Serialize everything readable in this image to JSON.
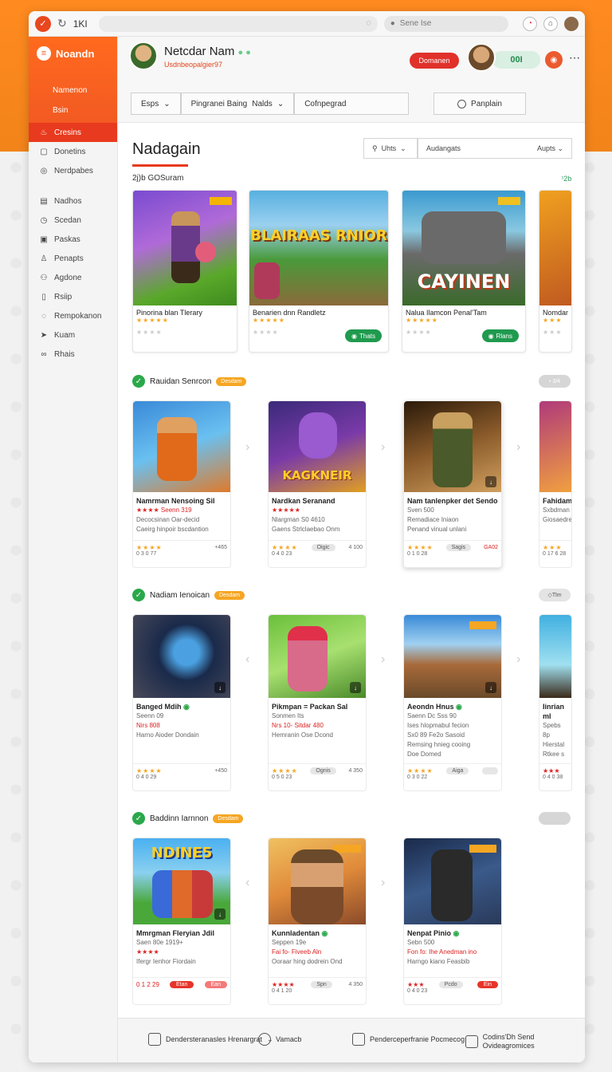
{
  "browser": {
    "tab_title": "1KI",
    "search_label": "Sene Ise"
  },
  "sidebar": {
    "logo": "Noandn",
    "sub1": "Namenon",
    "sub2": "Bsin",
    "active": "Cresins",
    "items": [
      "Donetins",
      "Nerdpabes",
      "Nadhos",
      "Scedan",
      "Paskas",
      "Penapts",
      "Agdone",
      "Rsiip",
      "Rempokanon",
      "Kuam",
      "Rhais"
    ]
  },
  "header": {
    "user_name": "Netcdar Nam",
    "user_sub": "Usdnbeopalgier97",
    "red_button": "Domanen",
    "green_pill": "00I",
    "filters": [
      "Esps",
      "Pingranei Baing",
      "Nalds",
      "Cofnpegrad"
    ],
    "outline_button": "Panplain"
  },
  "main": {
    "title": "Nadagain",
    "search_label": "Uhts",
    "sort_label": "Audangats",
    "sort_value": "Aupts",
    "section_label": "2j)b GOSuram",
    "section_count": "⁳2b",
    "featured": [
      {
        "title": "Pinorina blan Tlerary",
        "art": "",
        "button": ""
      },
      {
        "title": "Benarien dnn Randletz",
        "art": "BLAIRAAS RNIOR",
        "button": "Thats"
      },
      {
        "title": "Nalua Ilamcon Penal'Tam",
        "art": "CAYINEN",
        "button": "Rlans"
      },
      {
        "title": "Nomdan",
        "art": "",
        "button": ""
      }
    ],
    "sections": [
      {
        "name": "Rauidan Senrcon",
        "tag": "Desdam",
        "more": "• 3/4",
        "cards": [
          {
            "title": "Namrman Nensoing Sil",
            "lines": [
              "Seenn 319",
              "Decocsinan Oar-decid",
              "Caeirg hinpoir bscdantion"
            ],
            "meta1": "+465",
            "meta2": "0 3 0 77",
            "chip": "",
            "chip_style": "",
            "art": ""
          },
          {
            "title": "Nardkan Seranand",
            "lines": [
              "Nlargman S0 4610",
              "Gaens Strlclaebao Onm"
            ],
            "meta1": "4 100",
            "meta2": "0 4 0 23",
            "chip": "Oigic",
            "chip_style": "gray",
            "art": "KAGKNEIR"
          },
          {
            "title": "Nam tanlenpker det Sendo",
            "lines": [
              "Sven 500",
              "Remadiace Iniaon",
              "Penand vinual unlani"
            ],
            "meta1": "GA02",
            "meta2": "0 1 0 28",
            "chip": "Sagis",
            "chip_style": "gray",
            "art": ""
          },
          {
            "title": "Fahidam",
            "lines": [
              "Sxbdman",
              "Giosaedre"
            ],
            "meta1": "",
            "meta2": "0 17 6 28",
            "chip": "",
            "chip_style": "",
            "art": ""
          }
        ]
      },
      {
        "name": "Nadiam Ienoican",
        "tag": "Desdam",
        "more": "Tlm",
        "cards": [
          {
            "title": "Banged Mdih",
            "lines": [
              "Seenn 09",
              "Nirs 808",
              "Harno Aioder Dondain"
            ],
            "meta1": "+450",
            "meta2": "0 4 0 29",
            "chip": "",
            "chip_style": "",
            "art": ""
          },
          {
            "title": "Pikmpan = Packan Sal",
            "lines": [
              "Sonmen Its",
              "Nrs 10- Sitdar 480",
              "Hemranin Ose Dcond"
            ],
            "meta1": "4 350",
            "meta2": "0 5 0 23",
            "chip": "Ognis",
            "chip_style": "gray",
            "art": ""
          },
          {
            "title": "Aeondn Hnus",
            "lines": [
              "Saenn Dc Sss 90",
              "Ises hlopmabul fecion",
              "Sx0 89 Fe2o Sasoid",
              "Remsing hnieg cooing",
              "Doe Domed"
            ],
            "meta1": "",
            "meta2": "0 3 0 22",
            "chip": "Aiga",
            "chip_style": "gray",
            "art": ""
          },
          {
            "title": "Iinrian ml",
            "lines": [
              "Spebs 8p",
              "Hierstal",
              "Rtkee s"
            ],
            "meta1": "",
            "meta2": "0 4 0 38",
            "chip": "",
            "chip_style": "",
            "art": ""
          }
        ]
      },
      {
        "name": "Baddinn Iarnnon",
        "tag": "Desdam",
        "more": "",
        "cards": [
          {
            "title": "Mmrgman Fleryian Jdil",
            "lines": [
              "Saen 80e 1919+",
              "Ifergr Ienhor Fiordain"
            ],
            "meta1": "",
            "meta2": "0 1 2 29",
            "chip": "Etan",
            "chip_style": "red",
            "chip2": "Ean",
            "art": "NDINE5"
          },
          {
            "title": "Kunnladentan",
            "lines": [
              "Seppen 19e",
              "Fai fo- Fiveeb Aln",
              "Ooraar hing dodrein Ond"
            ],
            "meta1": "4 350",
            "meta2": "0 4 1 20",
            "chip": "Spn",
            "chip_style": "gray",
            "art": ""
          },
          {
            "title": "Nenpat Pinio",
            "lines": [
              "Sebn 500",
              "Fon fo: Ihe Anedman ino",
              "Harngo kiano Feasbib"
            ],
            "meta1": "",
            "meta2": "0 4 0 23",
            "chip": "Pcdo",
            "chip_style": "gray",
            "chip2": "Ein",
            "art": ""
          }
        ]
      }
    ]
  },
  "footer": {
    "items": [
      "Dendersteranasles Hrenargrat",
      "Vamacb",
      "Penderceperfranie Pocmecog",
      "Codins'Dh Send Ovideagromices"
    ]
  }
}
